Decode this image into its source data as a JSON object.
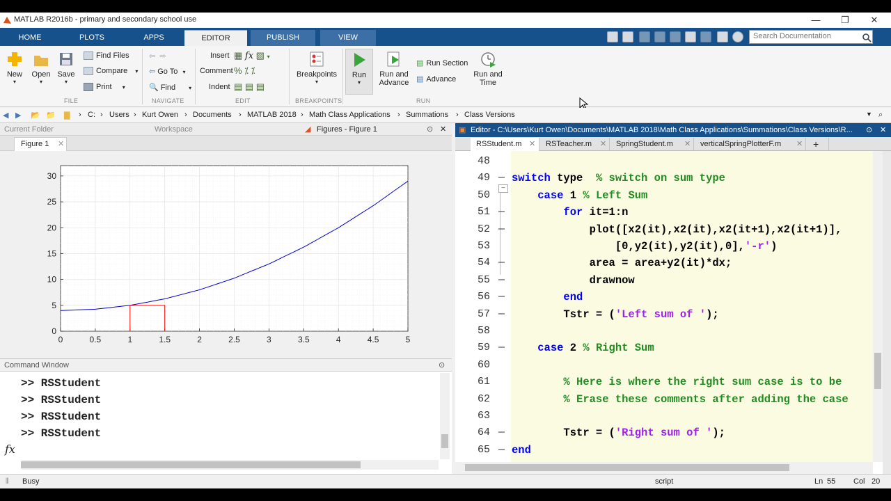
{
  "window": {
    "title": "MATLAB R2016b - primary and secondary school use",
    "minimize": "—",
    "restore": "❐",
    "close": "✕"
  },
  "ribbon_tabs": [
    "HOME",
    "PLOTS",
    "APPS",
    "EDITOR",
    "PUBLISH",
    "VIEW"
  ],
  "search": {
    "placeholder": "Search Documentation"
  },
  "ribbon": {
    "file": {
      "new": "New",
      "open": "Open",
      "save": "Save",
      "find_files": "Find Files",
      "compare": "Compare",
      "print": "Print",
      "group": "FILE"
    },
    "navigate": {
      "go_to": "Go To",
      "find": "Find",
      "group": "NAVIGATE"
    },
    "edit": {
      "insert": "Insert",
      "comment": "Comment",
      "indent": "Indent",
      "group": "EDIT"
    },
    "breakpoints": {
      "label": "Breakpoints",
      "group": "BREAKPOINTS"
    },
    "run": {
      "run": "Run",
      "run_and_advance": [
        "Run and",
        "Advance"
      ],
      "run_section": "Run Section",
      "advance": "Advance",
      "run_and_time": [
        "Run and",
        "Time"
      ],
      "group": "RUN"
    }
  },
  "address_bar": {
    "path": [
      "C:",
      "Users",
      "Kurt Owen",
      "Documents",
      "MATLAB 2018",
      "Math Class Applications",
      "Summations",
      "Class Versions"
    ]
  },
  "panels": {
    "current_folder": "Current Folder",
    "workspace": "Workspace",
    "figures": "Figures - Figure 1",
    "figure_tab": "Figure 1",
    "command_window": "Command Window",
    "fx": "fx"
  },
  "chart_data": {
    "type": "line",
    "title": "",
    "xlabel": "",
    "ylabel": "",
    "xlim": [
      0,
      5
    ],
    "ylim": [
      0,
      32
    ],
    "xticks": [
      "0",
      "0.5",
      "1",
      "1.5",
      "2",
      "2.5",
      "3",
      "3.5",
      "4",
      "4.5",
      "5"
    ],
    "yticks": [
      "0",
      "5",
      "10",
      "15",
      "20",
      "25",
      "30"
    ],
    "grid": "minor",
    "series": [
      {
        "color": "#0000cc",
        "x": [
          0,
          0.5,
          1,
          1.5,
          2,
          2.5,
          3,
          3.5,
          4,
          4.5,
          5
        ],
        "y": [
          4,
          4.25,
          5,
          6.25,
          8,
          10.25,
          13,
          16.25,
          20,
          24.25,
          29
        ]
      },
      {
        "color": "#ff0000",
        "x": [
          1,
          1,
          1.5,
          1.5
        ],
        "y": [
          0,
          5,
          5,
          0
        ]
      }
    ]
  },
  "command_window": {
    "lines": [
      ">> RSStudent",
      ">> RSStudent",
      ">> RSStudent",
      ">> RSStudent"
    ]
  },
  "editor": {
    "title": "Editor - C:\\Users\\Kurt Owen\\Documents\\MATLAB 2018\\Math Class Applications\\Summations\\Class Versions\\R...",
    "tabs": [
      "RSStudent.m",
      "RSTeacher.m",
      "SpringStudent.m",
      "verticalSpringPlotterF.m"
    ],
    "add_tab": "+",
    "lines": [
      {
        "n": "48",
        "dash": false,
        "segs": []
      },
      {
        "n": "49",
        "dash": true,
        "segs": [
          [
            "kw",
            "switch"
          ],
          [
            "",
            " type  "
          ],
          [
            "cm",
            "% switch on sum type"
          ]
        ]
      },
      {
        "n": "50",
        "dash": false,
        "segs": [
          [
            "",
            "    "
          ],
          [
            "kw",
            "case"
          ],
          [
            "",
            " 1 "
          ],
          [
            "cm",
            "% Left Sum"
          ]
        ]
      },
      {
        "n": "51",
        "dash": true,
        "segs": [
          [
            "",
            "        "
          ],
          [
            "kw",
            "for"
          ],
          [
            "",
            " it=1:n"
          ]
        ]
      },
      {
        "n": "52",
        "dash": true,
        "segs": [
          [
            "",
            "            plot([x2(it),x2(it),x2(it+1),x2(it+1)],"
          ]
        ]
      },
      {
        "n": "53",
        "dash": false,
        "segs": [
          [
            "",
            "                [0,y2(it),y2(it),0],"
          ],
          [
            "st",
            "'-r'"
          ],
          [
            "",
            ")"
          ]
        ]
      },
      {
        "n": "54",
        "dash": true,
        "segs": [
          [
            "",
            "            area = area+y2(it)*dx;"
          ]
        ]
      },
      {
        "n": "55",
        "dash": true,
        "segs": [
          [
            "",
            "            drawnow"
          ]
        ]
      },
      {
        "n": "56",
        "dash": true,
        "segs": [
          [
            "",
            "        "
          ],
          [
            "kw",
            "end"
          ]
        ]
      },
      {
        "n": "57",
        "dash": true,
        "segs": [
          [
            "",
            "        Tstr = ("
          ],
          [
            "st",
            "'Left sum of '"
          ],
          [
            "",
            ");"
          ]
        ]
      },
      {
        "n": "58",
        "dash": false,
        "segs": []
      },
      {
        "n": "59",
        "dash": true,
        "segs": [
          [
            "",
            "    "
          ],
          [
            "kw",
            "case"
          ],
          [
            "",
            " 2 "
          ],
          [
            "cm",
            "% Right Sum"
          ]
        ]
      },
      {
        "n": "60",
        "dash": false,
        "segs": []
      },
      {
        "n": "61",
        "dash": false,
        "segs": [
          [
            "",
            "        "
          ],
          [
            "cm",
            "% Here is where the right sum case is to be"
          ]
        ]
      },
      {
        "n": "62",
        "dash": false,
        "segs": [
          [
            "",
            "        "
          ],
          [
            "cm",
            "% Erase these comments after adding the case"
          ]
        ]
      },
      {
        "n": "63",
        "dash": false,
        "segs": []
      },
      {
        "n": "64",
        "dash": true,
        "segs": [
          [
            "",
            "        Tstr = ("
          ],
          [
            "st",
            "'Right sum of '"
          ],
          [
            "",
            ");"
          ]
        ]
      },
      {
        "n": "65",
        "dash": true,
        "segs": [
          [
            "kw",
            "end"
          ]
        ]
      }
    ]
  },
  "status": {
    "busy": "Busy",
    "type": "script",
    "ln_label": "Ln",
    "ln": "55",
    "col_label": "Col",
    "col": "20"
  },
  "colors": {
    "accent": "#16518c",
    "code_bg": "#fbfbe1",
    "keyword": "#0000ff",
    "comment": "#228b22",
    "string": "#a020f0"
  }
}
